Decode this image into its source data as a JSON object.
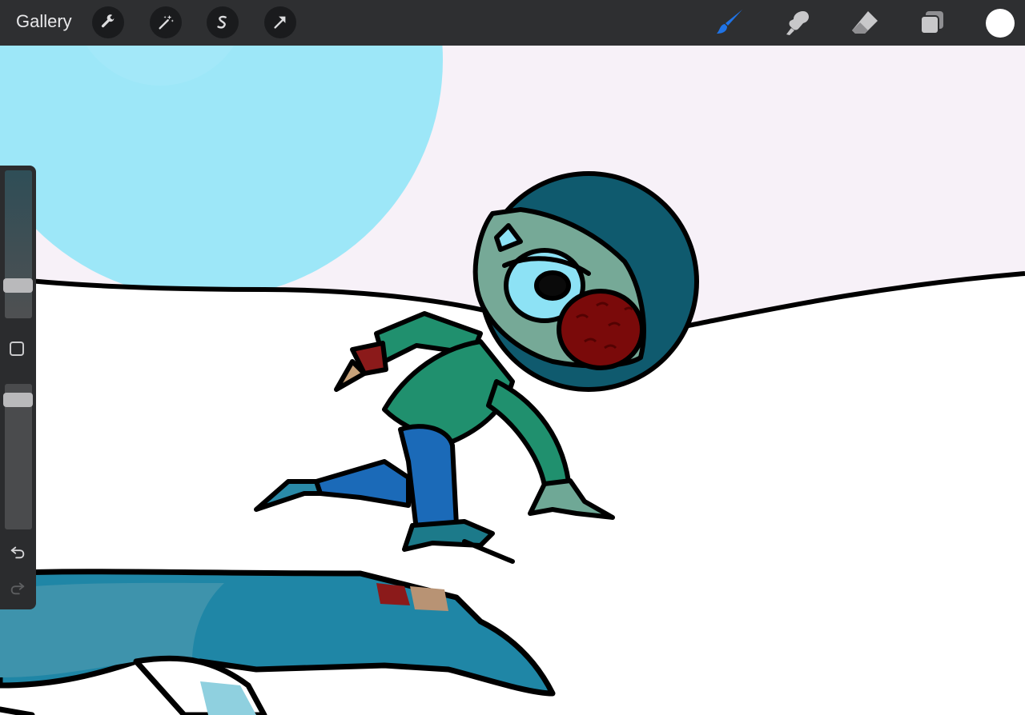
{
  "toolbar": {
    "gallery_label": "Gallery",
    "left_tools": [
      "wrench-icon",
      "magic-wand-icon",
      "selection-icon",
      "transform-arrow-icon"
    ],
    "right_tools": [
      "brush-icon",
      "smudge-icon",
      "eraser-icon",
      "layers-icon"
    ],
    "active_tool": "brush",
    "active_color": "#1f73e6",
    "current_color": "#ffffff"
  },
  "sidebar": {
    "brush_size_level": 0.19,
    "brush_opacity_level": 0.93,
    "controls": [
      "modify-square-icon",
      "undo-icon",
      "redo-icon"
    ]
  },
  "canvas": {
    "sky_color": "#f7f1f8",
    "sun_color": "#9de7f8",
    "ground_color": "#ffffff"
  }
}
